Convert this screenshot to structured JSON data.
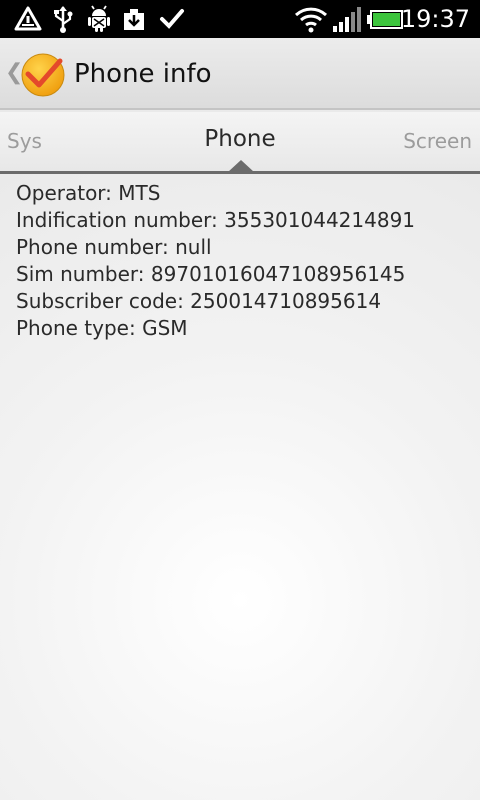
{
  "status_bar": {
    "time": "19:37",
    "left_icons": [
      "triangle-warning-icon",
      "usb-icon",
      "android-debug-icon",
      "download-icon",
      "checkmark-icon"
    ],
    "right_icons": [
      "wifi-icon",
      "signal-bars-icon",
      "battery-icon"
    ],
    "battery_level": 1.0,
    "battery_color": "#3cc43c"
  },
  "action_bar": {
    "title": "Phone info",
    "app_icon_colors": {
      "circle": "#f5b21f",
      "check": "#e4492b"
    }
  },
  "tabs": {
    "left": "Sys",
    "selected": "Phone",
    "right": "Screen"
  },
  "info": [
    "Operator: MTS",
    "Indification number: 355301044214891",
    "Phone number: null",
    "Sim number: 89701016047108956145",
    "Subscriber code: 250014710895614",
    "Phone type: GSM"
  ]
}
